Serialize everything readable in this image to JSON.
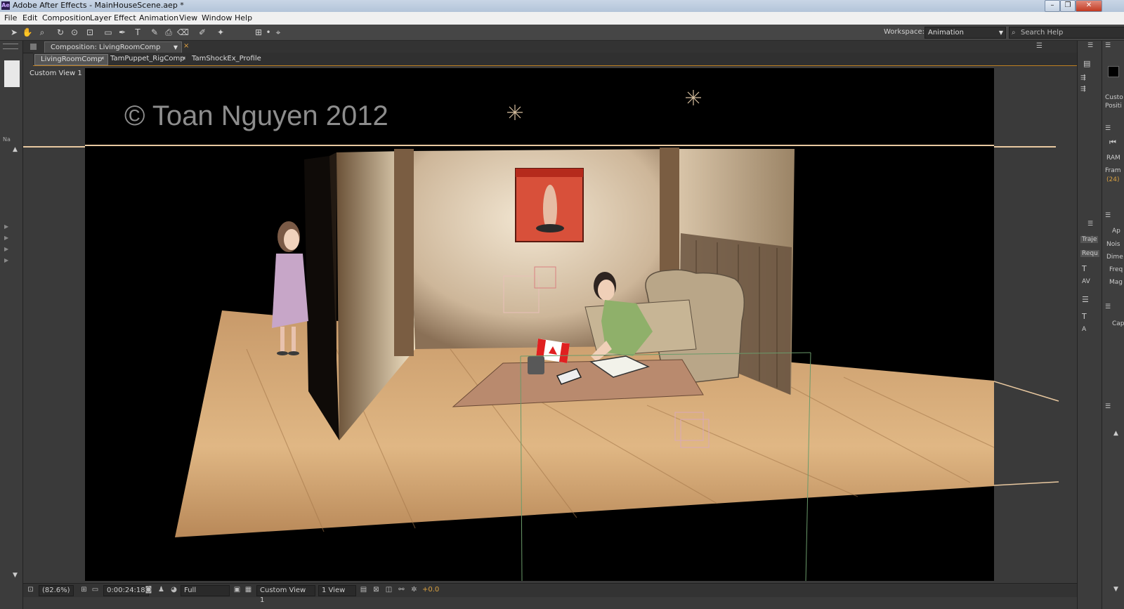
{
  "window": {
    "title": "Adobe After Effects - MainHouseScene.aep *",
    "app_icon": "Ae",
    "minimize": "–",
    "restore": "❐",
    "close": "✕"
  },
  "menu": [
    "File",
    "Edit",
    "Composition",
    "Layer",
    "Effect",
    "Animation",
    "View",
    "Window",
    "Help"
  ],
  "tools_bar": {
    "workspace_label": "Workspace:",
    "workspace_value": "Animation",
    "search_placeholder": "Search Help"
  },
  "composition_panel": {
    "tab_label": "Composition: LivingRoomComp",
    "flowchart": [
      "LivingRoomComp",
      "TamPuppet_RigComp",
      "TamShockEx_Profile"
    ],
    "view_label": "Custom View 1",
    "watermark": "© Toan Nguyen 2012"
  },
  "viewer_bar": {
    "magnification": "(82.6%)",
    "timecode": "0:00:24:18",
    "resolution": "Full",
    "view": "Custom View 1",
    "view_layout": "1 View",
    "exposure": "+0.0"
  },
  "left_panel": {
    "name_header": "Na"
  },
  "right_panel": {
    "labels": [
      "Custo",
      "Positi",
      "RAM",
      "Fram",
      "(24)",
      "Ap",
      "Nois",
      "Dime",
      "Freq",
      "Mag",
      "Cap"
    ],
    "fields": [
      "Traje",
      "Requ"
    ]
  },
  "colors": {
    "accent_orange": "#c08020",
    "viewer_bg": "#000000",
    "panel_bg": "#3a3a3a"
  }
}
